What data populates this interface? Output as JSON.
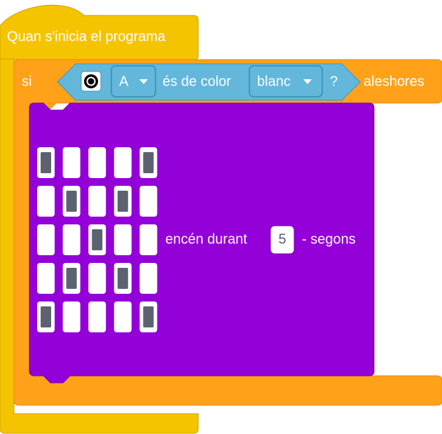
{
  "hat_block": {
    "label": "Quan s'inicia el programa",
    "color": "#F5C401"
  },
  "if_block": {
    "if_label": "si",
    "then_label": "aleshores",
    "color": "#FFA219"
  },
  "condition": {
    "port": "A",
    "middle_label": "és de color",
    "color_value": "blanc",
    "question_mark": "?",
    "color": "#62B7DB",
    "sensor_icon": "color-sensor-icon"
  },
  "light_block": {
    "prefix": "encén durant",
    "duration": "5",
    "suffix": "- segons",
    "color": "#9300D8",
    "matrix": [
      [
        1,
        0,
        0,
        0,
        1
      ],
      [
        0,
        1,
        0,
        1,
        0
      ],
      [
        0,
        0,
        1,
        0,
        0
      ],
      [
        0,
        1,
        0,
        1,
        0
      ],
      [
        1,
        0,
        0,
        0,
        1
      ]
    ]
  }
}
